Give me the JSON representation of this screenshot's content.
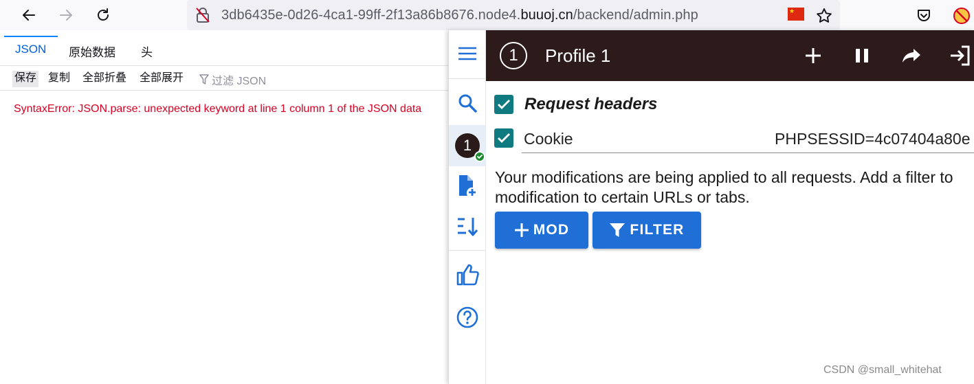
{
  "browser": {
    "url_prefix": "3db6435e-0d26-4ca1-99ff-2f13a86b8676.node4.",
    "url_host": "buuoj.cn",
    "url_path": "/backend/admin.php"
  },
  "json_viewer": {
    "tabs": [
      "JSON",
      "原始数据",
      "头"
    ],
    "actions": [
      "保存",
      "复制",
      "全部折叠",
      "全部展开"
    ],
    "filter_placeholder": "过滤 JSON",
    "error": "SyntaxError: JSON.parse: unexpected keyword at line 1 column 1 of the JSON data"
  },
  "modheader": {
    "profile_number": "1",
    "profile_title": "Profile 1",
    "section_label": "Request headers",
    "header_name": "Cookie",
    "header_value": "PHPSESSID=4c07404a80e",
    "info_line1": "Your modifications are being applied to all requests. Add a filter to",
    "info_line2": "modification to certain URLs or tabs.",
    "mod_button": "MOD",
    "filter_button": "FILTER",
    "accent_color": "#1f6fd6",
    "header_color": "#2d1b1b",
    "checkbox_color": "#0f7a80"
  },
  "watermark": "CSDN @small_whitehat"
}
